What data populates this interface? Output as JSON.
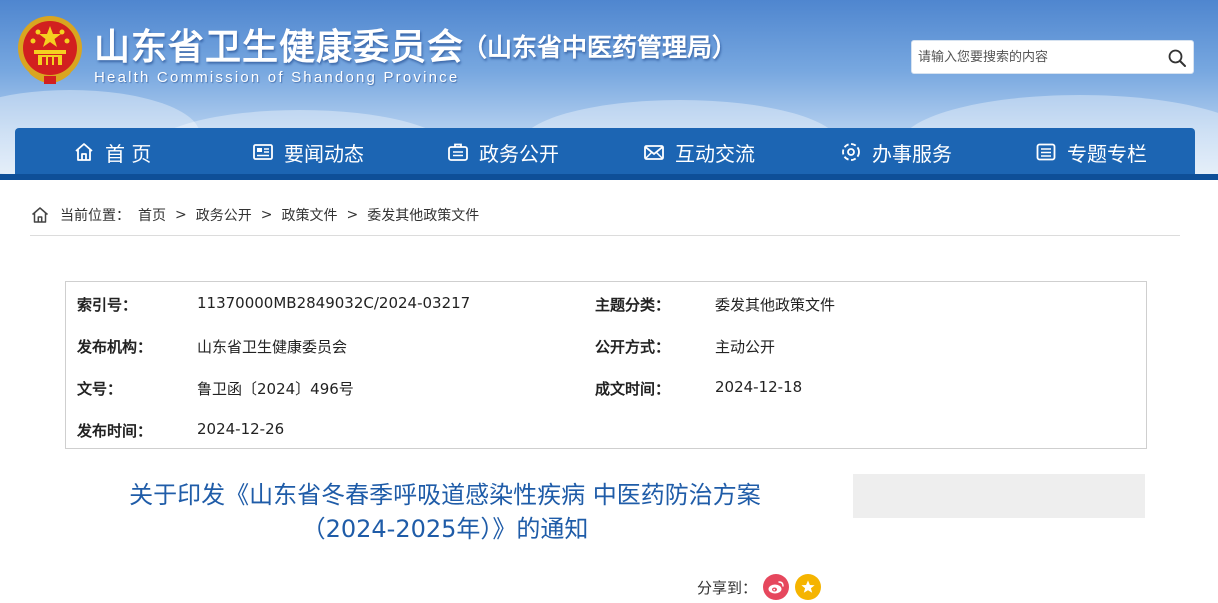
{
  "header": {
    "title": "山东省卫生健康委员会",
    "subtitle": "（山东省中医药管理局）",
    "title_en": "Health Commission of Shandong Province",
    "search_placeholder": "请输入您要搜索的内容",
    "search_icon": "magnifier-icon",
    "emblem": "national-emblem-icon"
  },
  "nav": {
    "items": [
      {
        "label": "首 页",
        "icon": "home-icon"
      },
      {
        "label": "要闻动态",
        "icon": "news-icon"
      },
      {
        "label": "政务公开",
        "icon": "briefcase-icon"
      },
      {
        "label": "互动交流",
        "icon": "envelope-icon"
      },
      {
        "label": "办事服务",
        "icon": "service-icon"
      },
      {
        "label": "专题专栏",
        "icon": "list-icon"
      }
    ]
  },
  "breadcrumb": {
    "prefix": "当前位置：",
    "items": [
      "首页",
      "政务公开",
      "政策文件",
      "委发其他政策文件"
    ],
    "separator": ">"
  },
  "meta": {
    "index_label": "索引号：",
    "index_value": "11370000MB2849032C/2024-03217",
    "category_label": "主题分类：",
    "category_value": "委发其他政策文件",
    "publisher_label": "发布机构：",
    "publisher_value": "山东省卫生健康委员会",
    "disclosure_label": "公开方式：",
    "disclosure_value": "主动公开",
    "docno_label": "文号：",
    "docno_value": "鲁卫函〔2024〕496号",
    "created_label": "成文时间：",
    "created_value": "2024-12-18",
    "published_label": "发布时间：",
    "published_value": "2024-12-26"
  },
  "document": {
    "title_line1": "关于印发《山东省冬春季呼吸道感染性疾病 中医药防治方案",
    "title_line2": "（2024-2025年）》的通知"
  },
  "share": {
    "label": "分享到：",
    "targets": [
      "weibo-icon",
      "favorite-star-icon"
    ]
  },
  "colors": {
    "nav_bg": "#1c65b3",
    "title_blue": "#1f5ca8",
    "weibo": "#e6475d",
    "star": "#f5b400"
  }
}
